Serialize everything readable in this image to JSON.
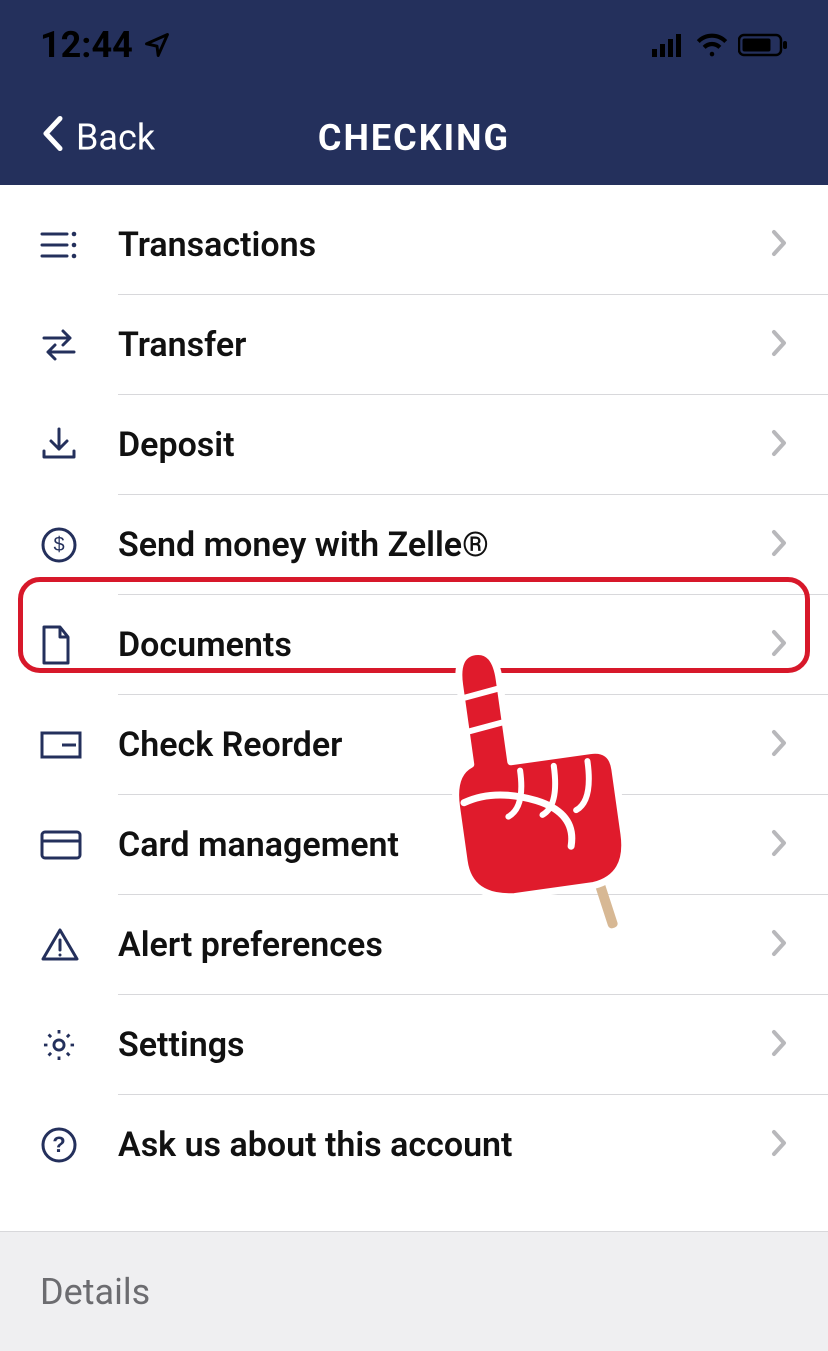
{
  "status": {
    "time": "12:44",
    "location_icon": "location-arrow",
    "signal_icon": "signal",
    "wifi_icon": "wifi",
    "battery_icon": "battery"
  },
  "nav": {
    "back_label": "Back",
    "title": "CHECKING"
  },
  "menu": {
    "items": [
      {
        "icon": "list-icon",
        "label": "Transactions"
      },
      {
        "icon": "transfer-icon",
        "label": "Transfer"
      },
      {
        "icon": "deposit-icon",
        "label": "Deposit"
      },
      {
        "icon": "zelle-icon",
        "label": "Send money with Zelle®"
      },
      {
        "icon": "document-icon",
        "label": "Documents"
      },
      {
        "icon": "check-icon",
        "label": "Check Reorder"
      },
      {
        "icon": "card-icon",
        "label": "Card management"
      },
      {
        "icon": "alert-icon",
        "label": "Alert preferences"
      },
      {
        "icon": "settings-icon",
        "label": "Settings"
      },
      {
        "icon": "help-icon",
        "label": "Ask us about this account"
      }
    ]
  },
  "highlight": {
    "target_index": 4,
    "description": "Documents row highlighted"
  },
  "pointer": {
    "description": "Red foam hand pointing up at Documents"
  },
  "details": {
    "header": "Details"
  },
  "colors": {
    "brand_navy": "#24305c",
    "highlight_red": "#d7182a",
    "divider": "#d8d8db",
    "chevron": "#b8b8bb",
    "detail_bg": "#efeff1"
  }
}
